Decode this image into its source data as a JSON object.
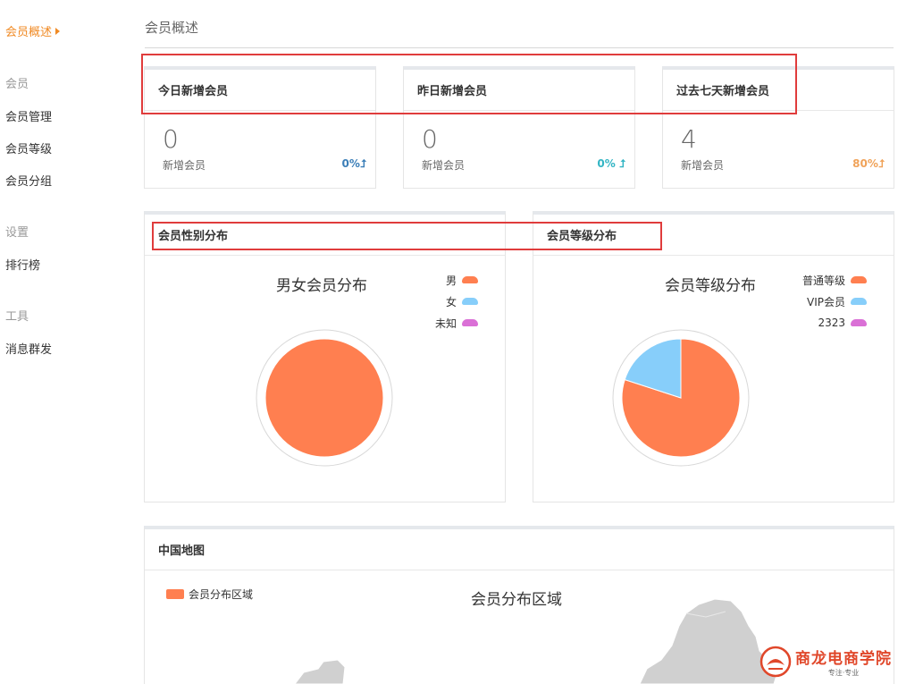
{
  "sidebar": {
    "active": "会员概述",
    "groups": [
      {
        "title": "会员",
        "items": [
          "会员管理",
          "会员等级",
          "会员分组"
        ]
      },
      {
        "title": "设置",
        "items": [
          "排行榜"
        ]
      },
      {
        "title": "工具",
        "items": [
          "消息群发"
        ]
      }
    ]
  },
  "page": {
    "title": "会员概述"
  },
  "stats": [
    {
      "title": "今日新增会员",
      "value": "0",
      "label": "新增会员",
      "percent": "0%",
      "color": "#3c7fb8"
    },
    {
      "title": "昨日新增会员",
      "value": "0",
      "label": "新增会员",
      "percent": "0%",
      "color": "#33b5c4"
    },
    {
      "title": "过去七天新增会员",
      "value": "4",
      "label": "新增会员",
      "percent": "80%",
      "color": "#f0a35a"
    }
  ],
  "charts": {
    "gender": {
      "panel_title": "会员性别分布"
    },
    "level": {
      "panel_title": "会员等级分布"
    },
    "map": {
      "panel_title": "中国地图",
      "legend_label": "会员分布区域"
    }
  },
  "chart_data": [
    {
      "type": "pie",
      "title": "男女会员分布",
      "categories": [
        "男",
        "女",
        "未知"
      ],
      "values": [
        100,
        0,
        0
      ],
      "colors": [
        "#ff7f50",
        "#87cefa",
        "#da70d6"
      ]
    },
    {
      "type": "pie",
      "title": "会员等级分布",
      "categories": [
        "普通等级",
        "VIP会员",
        "2323"
      ],
      "values": [
        80,
        20,
        0
      ],
      "colors": [
        "#ff7f50",
        "#87cefa",
        "#da70d6"
      ]
    },
    {
      "type": "map",
      "title": "会员分布区域"
    }
  ],
  "watermark": {
    "name": "商龙电商学院",
    "tagline": "专注·专业"
  }
}
